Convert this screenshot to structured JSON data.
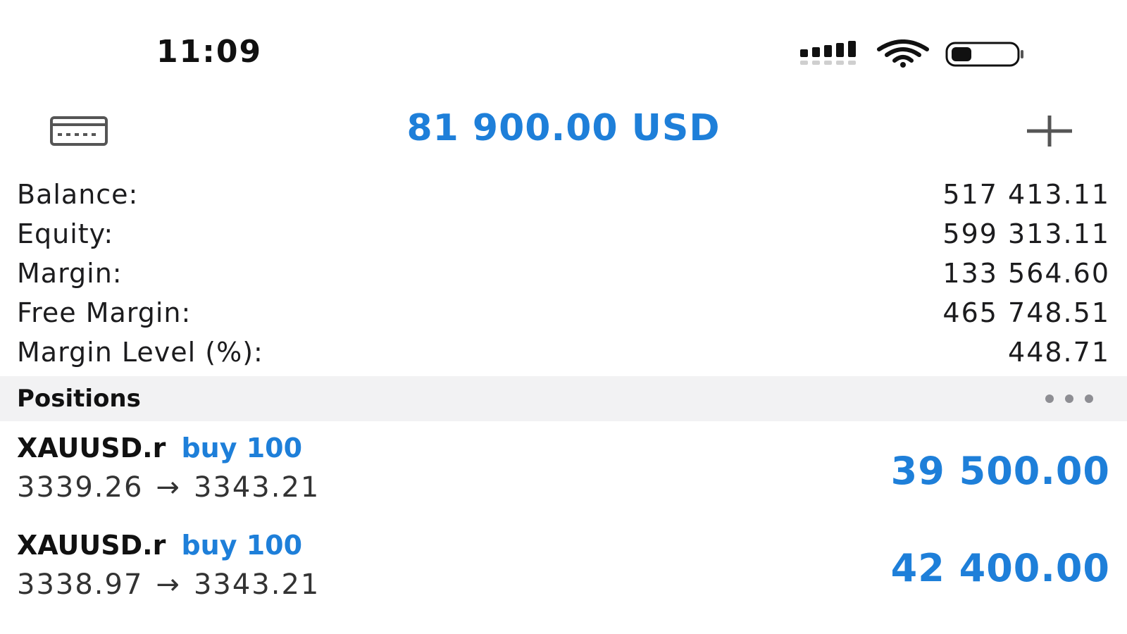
{
  "status_bar": {
    "time": "11:09",
    "icons": [
      "signal-icon",
      "wifi-icon",
      "battery-icon"
    ]
  },
  "header": {
    "title": "81 900.00 USD",
    "left_icon": "accounts-icon",
    "right_icon": "add-icon"
  },
  "summary": {
    "rows": [
      {
        "label": "Balance:",
        "value": "517 413.11"
      },
      {
        "label": "Equity:",
        "value": "599 313.11"
      },
      {
        "label": "Margin:",
        "value": "133 564.60"
      },
      {
        "label": "Free Margin:",
        "value": "465 748.51"
      },
      {
        "label": "Margin Level (%):",
        "value": "448.71"
      }
    ]
  },
  "positions": {
    "title": "Positions",
    "more_icon": "more-icon",
    "items": [
      {
        "symbol": "XAUUSD.r",
        "side": "buy 100",
        "open_price": "3339.26",
        "arrow": "→",
        "current_price": "3343.21",
        "profit": "39 500.00"
      },
      {
        "symbol": "XAUUSD.r",
        "side": "buy 100",
        "open_price": "3338.97",
        "arrow": "→",
        "current_price": "3343.21",
        "profit": "42 400.00"
      }
    ]
  },
  "colors": {
    "accent": "#1e7fd9",
    "text": "#1c1c1e",
    "section_bg": "#f2f2f3"
  }
}
